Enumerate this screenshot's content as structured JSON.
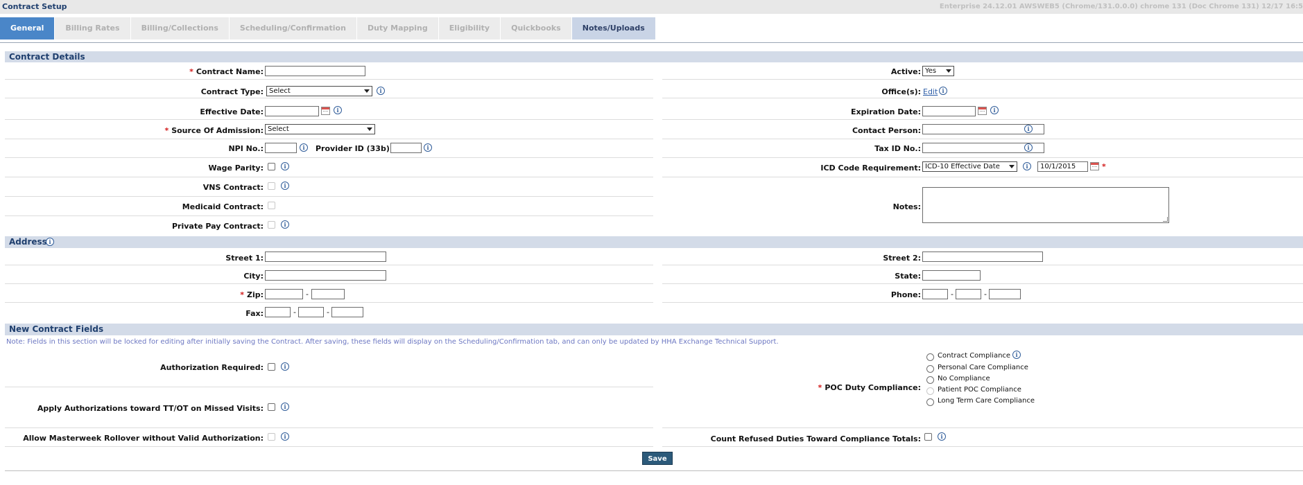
{
  "header": {
    "title": "Contract Setup",
    "version": "Enterprise 24.12.01 AWSWEB5 (Chrome/131.0.0.0) chrome 131 (Doc Chrome 131) 12/17 16:5"
  },
  "tabs": [
    {
      "label": "General"
    },
    {
      "label": "Billing Rates"
    },
    {
      "label": "Billing/Collections"
    },
    {
      "label": "Scheduling/Confirmation"
    },
    {
      "label": "Duty Mapping"
    },
    {
      "label": "Eligibility"
    },
    {
      "label": "Quickbooks"
    },
    {
      "label": "Notes/Uploads"
    }
  ],
  "sections": {
    "contract_details": "Contract Details",
    "address": "Address",
    "new_contract_fields": "New Contract Fields"
  },
  "required_mark": "*",
  "contract": {
    "contract_name": {
      "label": "Contract Name:",
      "value": ""
    },
    "contract_type": {
      "label": "Contract Type:",
      "value": "Select"
    },
    "effective_date": {
      "label": "Effective Date:",
      "value": ""
    },
    "source_of_admission": {
      "label": "Source Of Admission:",
      "value": "Select"
    },
    "npi_no": {
      "label": "NPI No.:",
      "value": ""
    },
    "provider_id": {
      "label": "Provider ID (33b):",
      "value": ""
    },
    "wage_parity": {
      "label": "Wage Parity:",
      "checked": false
    },
    "vns_contract": {
      "label": "VNS Contract:",
      "checked": false
    },
    "medicaid_contract": {
      "label": "Medicaid Contract:",
      "checked": false
    },
    "private_pay_contract": {
      "label": "Private Pay Contract:",
      "checked": false
    },
    "active": {
      "label": "Active:",
      "value": "Yes"
    },
    "offices": {
      "label": "Office(s):",
      "link": "Edit"
    },
    "expiration_date": {
      "label": "Expiration Date:",
      "value": ""
    },
    "contact_person": {
      "label": "Contact Person:",
      "value": ""
    },
    "tax_id": {
      "label": "Tax ID No.:",
      "value": ""
    },
    "icd_code": {
      "label": "ICD Code Requirement:",
      "value": "ICD-10 Effective Date",
      "date": "10/1/2015"
    },
    "notes": {
      "label": "Notes:",
      "value": ""
    }
  },
  "address": {
    "street1": {
      "label": "Street 1:",
      "value": ""
    },
    "city": {
      "label": "City:",
      "value": ""
    },
    "zip": {
      "label": "Zip:"
    },
    "fax": {
      "label": "Fax:"
    },
    "street2": {
      "label": "Street 2:",
      "value": ""
    },
    "state": {
      "label": "State:",
      "value": ""
    },
    "phone": {
      "label": "Phone:"
    },
    "separator": "-"
  },
  "new_fields": {
    "note": "Note: Fields in this section will be locked for editing after initially saving the Contract. After saving, these fields will display on the Scheduling/Confirmation tab, and can only be updated by HHA Exchange Technical Support.",
    "authorization_required": {
      "label": "Authorization Required:",
      "checked": false
    },
    "apply_authorizations": {
      "label": "Apply Authorizations toward TT/OT on Missed Visits:",
      "checked": false
    },
    "allow_masterweek": {
      "label": "Allow Masterweek Rollover without Valid Authorization:",
      "checked": false
    },
    "poc_duty_compliance": {
      "label": "POC Duty Compliance:",
      "options": [
        {
          "label": "Contract Compliance"
        },
        {
          "label": "Personal Care Compliance"
        },
        {
          "label": "No Compliance"
        },
        {
          "label": "Patient POC Compliance"
        },
        {
          "label": "Long Term Care Compliance"
        }
      ]
    },
    "count_refused": {
      "label": "Count Refused Duties Toward Compliance Totals:",
      "checked": false
    }
  },
  "save_label": "Save",
  "info_glyph": "i"
}
